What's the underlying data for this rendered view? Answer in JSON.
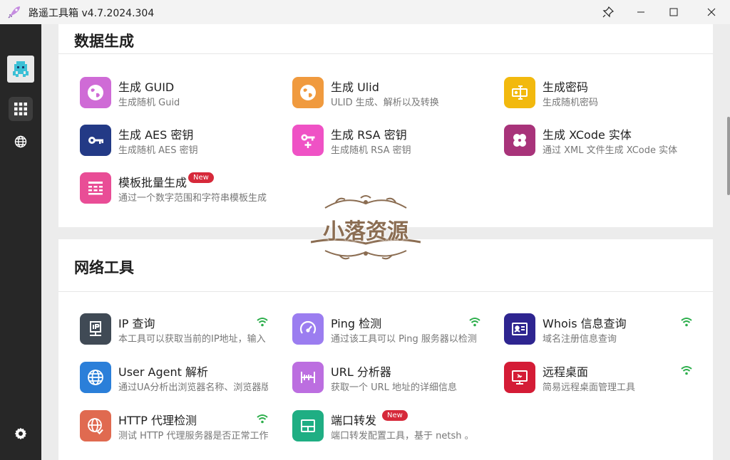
{
  "window": {
    "title": "路遥工具箱 v4.7.2024.304"
  },
  "sidebar": {
    "items": [
      {
        "icon": "app-logo-icon"
      },
      {
        "icon": "grid-icon"
      },
      {
        "icon": "globe-icon"
      },
      {
        "icon": "settings-icon"
      }
    ]
  },
  "sections": [
    {
      "title": "数据生成",
      "tools": [
        {
          "name": "生成 GUID",
          "desc": "生成随机 Guid",
          "color": "#cf6bd6",
          "icon": "globe-icon"
        },
        {
          "name": "生成 Ulid",
          "desc": "ULID 生成、解析以及转换",
          "color": "#f09a3e",
          "icon": "globe-icon"
        },
        {
          "name": "生成密码",
          "desc": "生成随机密码",
          "color": "#f2b90e",
          "icon": "password-icon"
        },
        {
          "name": "生成 AES 密钥",
          "desc": "生成随机 AES 密钥",
          "color": "#233a86",
          "icon": "key-icon"
        },
        {
          "name": "生成 RSA 密钥",
          "desc": "生成随机 RSA 密钥",
          "color": "#ef52c5",
          "icon": "key-plus-icon"
        },
        {
          "name": "生成 XCode 实体",
          "desc": "通过 XML 文件生成 XCode 实体",
          "color": "#a8337a",
          "icon": "clover-icon"
        },
        {
          "name": "模板批量生成",
          "desc": "通过一个数字范围和字符串模板生成",
          "color": "#e94d96",
          "icon": "template-icon",
          "badge": "New"
        }
      ]
    },
    {
      "title": "网络工具",
      "tools": [
        {
          "name": "IP 查询",
          "desc": "本工具可以获取当前的IP地址，输入",
          "color": "#404a55",
          "icon": "ip-icon",
          "wifi": true
        },
        {
          "name": "Ping 检测",
          "desc": "通过该工具可以 Ping 服务器以检测",
          "color": "#9b7df0",
          "icon": "gauge-icon",
          "wifi": true
        },
        {
          "name": "Whois 信息查询",
          "desc": "域名注册信息查询",
          "color": "#2e2590",
          "icon": "id-card-icon",
          "wifi": true
        },
        {
          "name": "User Agent 解析",
          "desc": "通过UA分析出浏览器名称、浏览器版",
          "color": "#2b7fd9",
          "icon": "globe-icon"
        },
        {
          "name": "URL 分析器",
          "desc": "获取一个 URL 地址的详细信息",
          "color": "#bc6ee0",
          "icon": "ruler-icon"
        },
        {
          "name": "远程桌面",
          "desc": "简易远程桌面管理工具",
          "color": "#d41c36",
          "icon": "remote-desktop-icon",
          "wifi": true
        },
        {
          "name": "HTTP 代理检测",
          "desc": "测试 HTTP 代理服务器是否正常工作",
          "color": "#e06a50",
          "icon": "globe-check-icon",
          "wifi": true
        },
        {
          "name": "端口转发",
          "desc": "端口转发配置工具，基于 netsh 。",
          "color": "#1fae83",
          "icon": "port-icon",
          "badge": "New"
        }
      ]
    }
  ],
  "watermark": {
    "text": "小落资源"
  }
}
